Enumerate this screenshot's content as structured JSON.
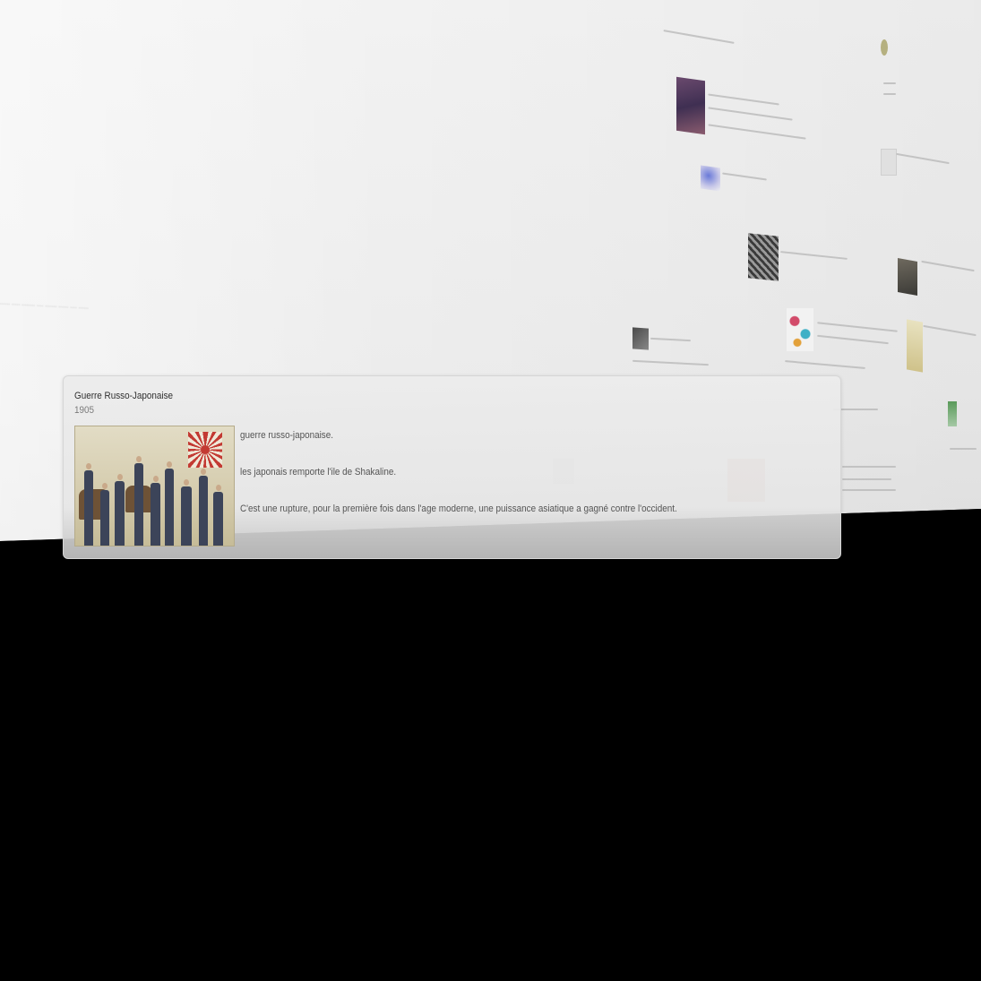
{
  "timeline": {
    "far_caption": "...... ..... ........ .... ....... ...... .... ......"
  },
  "event_popup": {
    "title": "Guerre Russo-Japonaise",
    "date": "1905",
    "image_icon": "historical-illustration-image",
    "paragraphs": [
      "guerre russo-japonaise.",
      "les japonais remporte l'ile de Shakaline.",
      "C'est une rupture, pour la première fois dans l'age moderne, une puissance asiatique a gagné contre l'occident."
    ]
  }
}
